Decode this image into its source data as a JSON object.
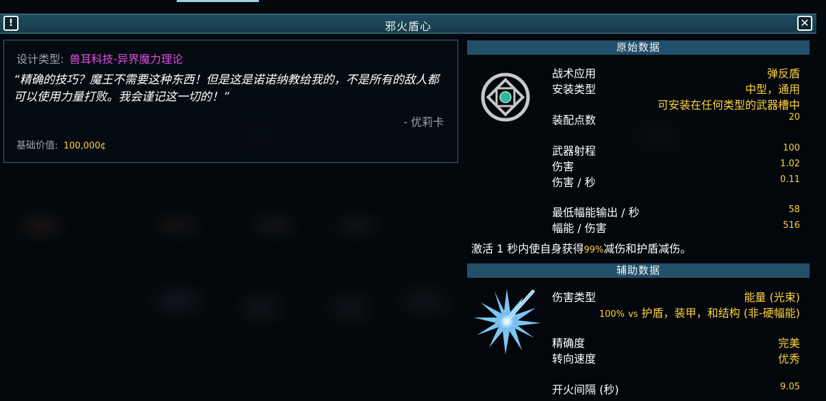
{
  "window": {
    "title": "邪火盾心",
    "info_icon": "exclamation-icon",
    "close_icon": "close-x-icon"
  },
  "description": {
    "design_type_label": "设计类型:",
    "design_type_value": "兽耳科技-异界魔力理论",
    "quote": "“精确的技巧？魔王不需要这种东西！但是这是诺诺纳教给我的，不是所有的敌人都可以使用力量打败。我会谨记这一切的！”",
    "author": "- 优莉卡",
    "base_value_label": "基础价值:",
    "base_value": "100,000¢"
  },
  "primary": {
    "header": "原始数据",
    "icon": "shield-emblem-icon",
    "tactical_label": "战术应用",
    "tactical_value": "弹反盾",
    "mount_label": "安装类型",
    "mount_value": "中型，通用",
    "mount_note": "可安装在任何类型的武器槽中",
    "op_label": "装配点数",
    "op_value": "20",
    "range_label": "武器射程",
    "range_value": "100",
    "damage_label": "伤害",
    "damage_value": "1.02",
    "dps_label": "伤害 / 秒",
    "dps_value": "0.11",
    "flux_min_label": "最低幅能输出 / 秒",
    "flux_min_value": "58",
    "flux_per_damage_label": "幅能 / 伤害",
    "flux_per_damage_value": "516",
    "activate_prefix": "激活 1 秒内使自身获得",
    "activate_pct": "99%",
    "activate_suffix": "减伤和护盾减伤。"
  },
  "secondary": {
    "header": "辅助数据",
    "icon": "energy-burst-icon",
    "damage_type_label": "伤害类型",
    "damage_type_value": "能量 (光束)",
    "damage_pct": "100%",
    "damage_vs": "vs",
    "damage_targets": "护盾，装甲，和结构 (非-硬幅能)",
    "accuracy_label": "精确度",
    "accuracy_value": "完美",
    "turn_label": "转向速度",
    "turn_value": "优秀",
    "refire_label": "开火间隔 (秒)",
    "refire_value": "9.05"
  },
  "colors": {
    "accent": "#22506b",
    "highlight": "#ffd23a",
    "design_type": "#e04ce0",
    "label": "#9aa7ad"
  }
}
